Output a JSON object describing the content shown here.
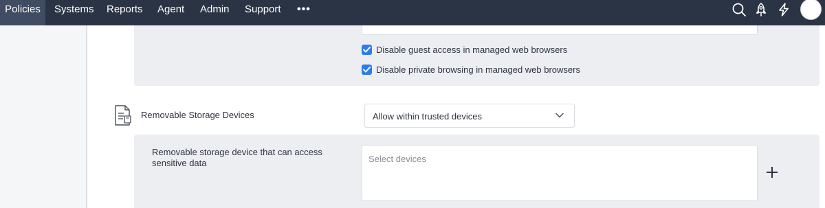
{
  "nav": {
    "items": [
      {
        "label": "Policies",
        "active": true
      },
      {
        "label": "Systems",
        "active": false
      },
      {
        "label": "Reports",
        "active": false
      },
      {
        "label": "Agent",
        "active": false
      },
      {
        "label": "Admin",
        "active": false
      },
      {
        "label": "Support",
        "active": false
      }
    ],
    "more_label": "•••",
    "icons": [
      "search-icon",
      "rocket-icon",
      "lightning-icon",
      "user-avatar"
    ]
  },
  "browser_options": {
    "disable_guest": {
      "label": "Disable guest access in managed web browsers",
      "checked": true
    },
    "disable_private": {
      "label": "Disable private browsing in managed web browsers",
      "checked": true
    }
  },
  "storage": {
    "title": "Removable Storage Devices",
    "dropdown_value": "Allow within trusted devices",
    "field_label": "Removable storage device that can access sensitive data",
    "select_placeholder": "Select devices"
  },
  "colors": {
    "nav_bg": "#2b3444",
    "nav_active": "#3f4c61",
    "accent": "#2b7de9",
    "section_bg": "#eceef2"
  }
}
